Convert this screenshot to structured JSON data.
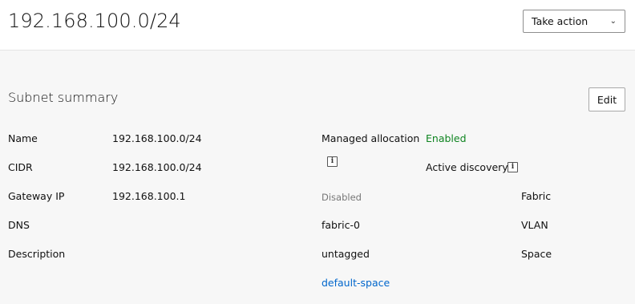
{
  "header": {
    "title": "192.168.100.0/24",
    "take_action_label": "Take action",
    "take_action_icon": "chevron-down-icon"
  },
  "summary": {
    "section_title": "Subnet summary",
    "edit_label": "Edit",
    "left_fields": [
      {
        "label": "Name",
        "value": "192.168.100.0/24"
      },
      {
        "label": "CIDR",
        "value": "192.168.100.0/24"
      },
      {
        "label": "Gateway IP",
        "value": "192.168.100.1"
      },
      {
        "label": "DNS",
        "value": ""
      },
      {
        "label": "Description",
        "value": ""
      }
    ],
    "managed_allocation": {
      "label": "Managed allocation",
      "value": "Enabled"
    },
    "active_discovery": {
      "label": "Active discovery",
      "value": "Disabled"
    },
    "fabric": {
      "label": "Fabric",
      "value": "fabric-0"
    },
    "vlan": {
      "label": "VLAN",
      "value": "untagged"
    },
    "space": {
      "label": "Space",
      "value": "default-space"
    },
    "info_icon_glyph": "i"
  },
  "colors": {
    "enabled_green": "#0e8420",
    "link_blue": "#0066cc",
    "muted_text": "#777777"
  }
}
